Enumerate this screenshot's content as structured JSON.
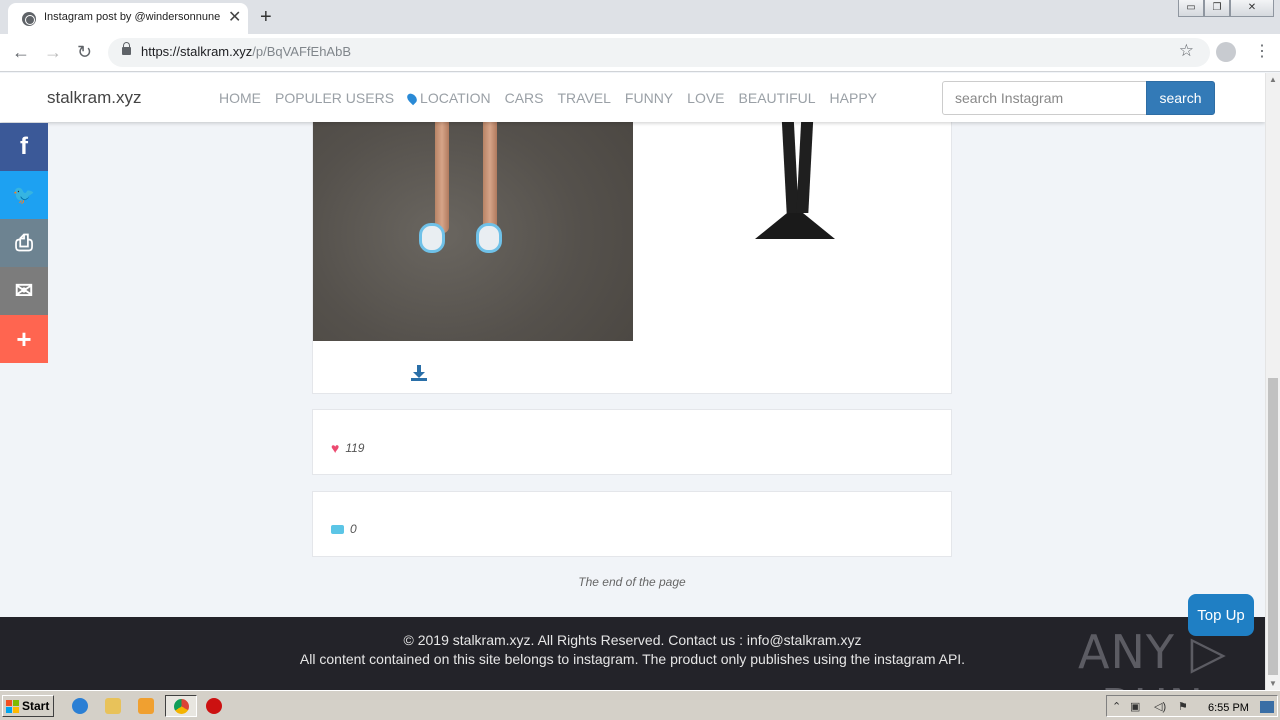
{
  "browser": {
    "tab_title": "Instagram post by @windersonnunes",
    "tab_close": "✕",
    "new_tab": "+",
    "url_host": "https://stalkram.xyz",
    "url_path": "/p/BqVAFfEhAbB",
    "window_controls": [
      "▭",
      "❐",
      "✕"
    ]
  },
  "site": {
    "brand": "stalkram.xyz",
    "menu": [
      "HOME",
      "POPULER USERS",
      "LOCATION",
      "CARS",
      "TRAVEL",
      "FUNNY",
      "LOVE",
      "BEAUTIFUL",
      "HAPPY"
    ],
    "search_placeholder": "search Instagram",
    "search_button": "search"
  },
  "post": {
    "likes": "119",
    "comments": "0",
    "end_text": "The end of the page"
  },
  "share": [
    {
      "name": "facebook",
      "glyph": "f",
      "color": "#3b5998"
    },
    {
      "name": "twitter",
      "glyph": "🐦",
      "color": "#1da1f2"
    },
    {
      "name": "print",
      "glyph": "⎙",
      "color": "#6d8391"
    },
    {
      "name": "email",
      "glyph": "✉",
      "color": "#7c7c7c"
    },
    {
      "name": "more",
      "glyph": "+",
      "color": "#ff6550"
    }
  ],
  "footer": {
    "line1": "© 2019 stalkram.xyz. All Rights Reserved. Contact us : info@stalkram.xyz",
    "line2": "All content contained on this site belongs to instagram. The product only publishes using the instagram API.",
    "watermark": "ANY ▷ RUN"
  },
  "top_up": "Top Up",
  "taskbar": {
    "start": "Start",
    "time": "6:55 PM"
  }
}
